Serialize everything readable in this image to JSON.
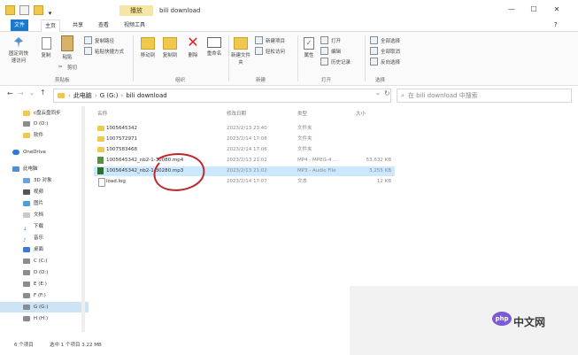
{
  "window": {
    "title": "bili download",
    "context_tab": "播放",
    "controls": [
      "—",
      "☐",
      "✕"
    ]
  },
  "tabs": {
    "file": "文件",
    "home": "主页",
    "share": "共享",
    "view": "查看",
    "video_tools": "视频工具"
  },
  "ribbon": {
    "clipboard": {
      "pin_label": "固定到快速访问",
      "copy_label": "复制",
      "paste_label": "粘贴",
      "copy_path": "复制路径",
      "paste_shortcut": "粘贴快捷方式",
      "cut": "剪切",
      "group": "剪贴板"
    },
    "organize": {
      "move_to": "移动到",
      "copy_to": "复制到",
      "delete": "删除",
      "rename": "重命名",
      "group": "组织"
    },
    "new": {
      "new_folder": "新建文件夹",
      "new_item": "新建项目",
      "easy_access": "轻松访问",
      "group": "新建"
    },
    "open": {
      "properties": "属性",
      "open": "打开",
      "edit": "编辑",
      "history": "历史记录",
      "group": "打开"
    },
    "select": {
      "select_all": "全部选择",
      "select_none": "全部取消",
      "invert": "反向选择",
      "group": "选择"
    }
  },
  "address": {
    "path": [
      "此电脑",
      "G (G:)",
      "bili download"
    ],
    "search_placeholder": "在 bili download 中搜索"
  },
  "nav": {
    "items": [
      {
        "label": "c盘云盘同步",
        "icon": "folder"
      },
      {
        "label": "D (D:)",
        "icon": "drive"
      },
      {
        "label": "软件",
        "icon": "folder"
      },
      {
        "label": "OneDrive",
        "icon": "cloud"
      },
      {
        "label": "此电脑",
        "icon": "pc"
      },
      {
        "label": "3D 对象",
        "icon": "folder"
      },
      {
        "label": "视频",
        "icon": "folder"
      },
      {
        "label": "图片",
        "icon": "folder"
      },
      {
        "label": "文档",
        "icon": "folder"
      },
      {
        "label": "下载",
        "icon": "download"
      },
      {
        "label": "音乐",
        "icon": "music"
      },
      {
        "label": "桌面",
        "icon": "folder"
      },
      {
        "label": "C (C:)",
        "icon": "drive"
      },
      {
        "label": "D (D:)",
        "icon": "drive"
      },
      {
        "label": "E (E:)",
        "icon": "drive"
      },
      {
        "label": "F (F:)",
        "icon": "drive"
      },
      {
        "label": "G (G:)",
        "icon": "drive"
      },
      {
        "label": "H (H:)",
        "icon": "drive"
      }
    ]
  },
  "list": {
    "columns": {
      "name": "名称",
      "date": "修改日期",
      "type": "类型",
      "size": "大小"
    },
    "rows": [
      {
        "name": "1005645342",
        "date": "2023/2/13 23:40",
        "type": "文件夹",
        "size": "",
        "icon": "folder"
      },
      {
        "name": "1007572971",
        "date": "2023/2/14 17:08",
        "type": "文件夹",
        "size": "",
        "icon": "folder"
      },
      {
        "name": "1007583468",
        "date": "2023/2/14 17:06",
        "type": "文件夹",
        "size": "",
        "icon": "folder"
      },
      {
        "name": "1005645342_nb2-1-30080.mp4",
        "date": "2023/2/13 21:02",
        "type": "MP4 - MPEG-4 ...",
        "size": "53,632 KB",
        "icon": "media"
      },
      {
        "name": "1005645342_nb2-1-30280.mp3",
        "date": "2023/2/13 21:02",
        "type": "MP3 - Audio File",
        "size": "3,255 KB",
        "icon": "media"
      },
      {
        "name": "load.log",
        "date": "2023/2/14 17:07",
        "type": "文本",
        "size": "12 KB",
        "icon": "file"
      }
    ]
  },
  "status": {
    "count": "6 个项目",
    "selected": "选中 1 个项目  3.22 MB"
  },
  "watermark": {
    "logo": "php",
    "site": "中文网"
  }
}
